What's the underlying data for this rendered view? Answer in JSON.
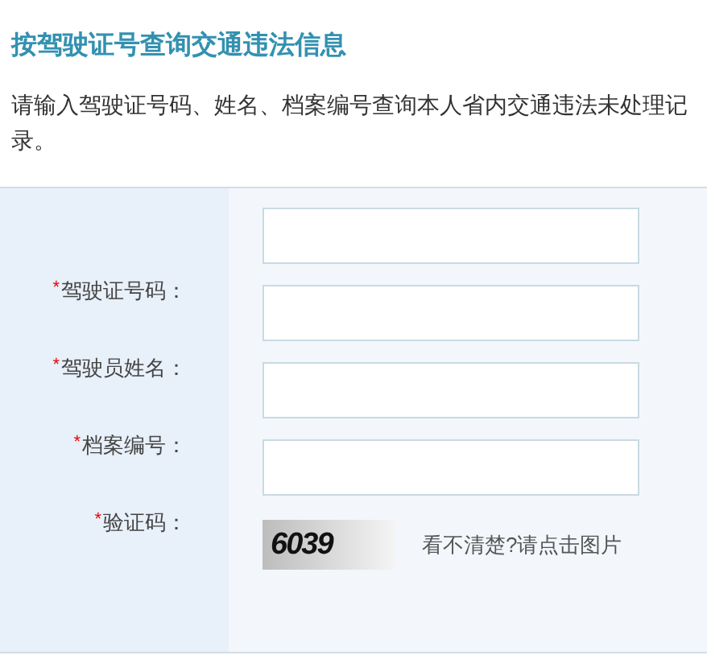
{
  "title": "按驾驶证号查询交通违法信息",
  "description": "请输入驾驶证号码、姓名、档案编号查询本人省内交通违法未处理记录。",
  "form": {
    "fields": [
      {
        "label": "驾驶证号码：",
        "required_mark": "*"
      },
      {
        "label": "驾驶员姓名：",
        "required_mark": "*"
      },
      {
        "label": "档案编号：",
        "required_mark": "*"
      },
      {
        "label": "验证码：",
        "required_mark": "*"
      }
    ],
    "captcha": {
      "code": "6039",
      "hint": "看不清楚?请点击图片"
    }
  }
}
